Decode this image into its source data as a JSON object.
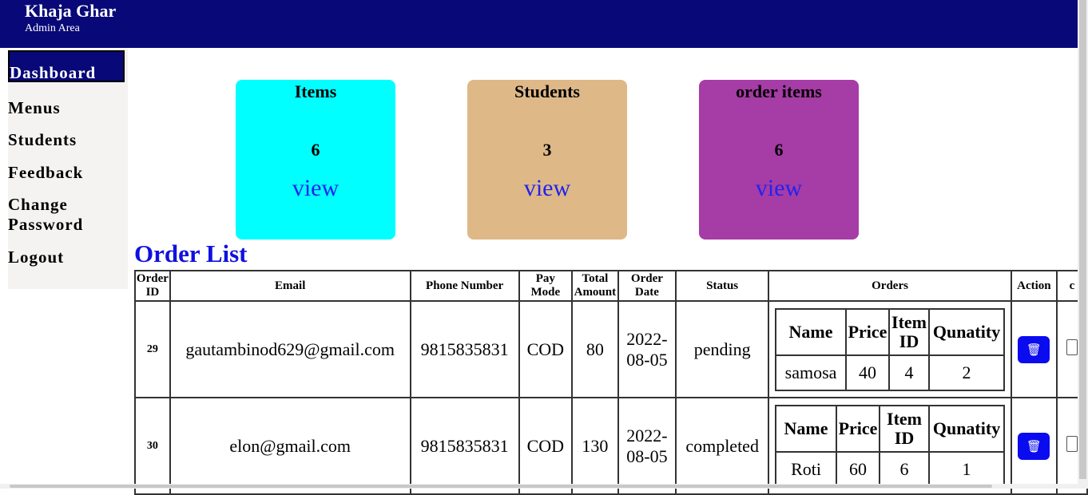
{
  "header": {
    "brand": "Khaja Ghar",
    "subtitle": "Admin Area"
  },
  "sidebar": {
    "items": [
      "Dashboard",
      "Menus",
      "Students",
      "Feedback",
      "Change Password",
      "Logout"
    ]
  },
  "cards": [
    {
      "title": "Items",
      "count": "6",
      "link": "view",
      "color": "#00ffff"
    },
    {
      "title": "Students",
      "count": "3",
      "link": "view",
      "color": "#deb887"
    },
    {
      "title": "order items",
      "count": "6",
      "link": "view",
      "color": "#a63ca6"
    }
  ],
  "order_list": {
    "title": "Order List",
    "columns": [
      "Order ID",
      "Email",
      "Phone Number",
      "Pay Mode",
      "Total Amount",
      "Order Date",
      "Status",
      "Orders",
      "Action",
      "c"
    ],
    "inner_columns": [
      "Name",
      "Price",
      "Item ID",
      "Qunatity"
    ],
    "rows": [
      {
        "id": "29",
        "email": "gautambinod629@gmail.com",
        "phone": "9815835831",
        "pay_mode": "COD",
        "total": "80",
        "date": "2022-08-05",
        "status": "pending",
        "items": [
          {
            "name": "samosa",
            "price": "40",
            "item_id": "4",
            "qty": "2"
          }
        ]
      },
      {
        "id": "30",
        "email": "elon@gmail.com",
        "phone": "9815835831",
        "pay_mode": "COD",
        "total": "130",
        "date": "2022-08-05",
        "status": "completed",
        "items": [
          {
            "name": "Roti",
            "price": "60",
            "item_id": "6",
            "qty": "1"
          }
        ]
      }
    ],
    "delete_icon": "trash-icon"
  }
}
